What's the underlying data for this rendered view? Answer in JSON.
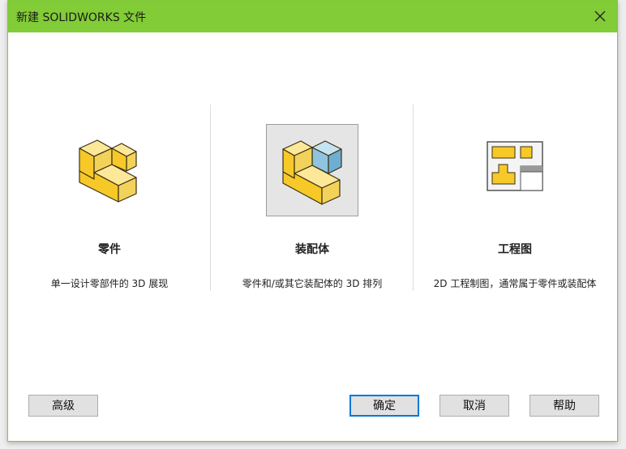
{
  "window": {
    "title": "新建 SOLIDWORKS 文件"
  },
  "options": [
    {
      "label": "零件",
      "description": "单一设计零部件的 3D 展现",
      "icon": "part-icon",
      "selected": false
    },
    {
      "label": "装配体",
      "description": "零件和/或其它装配体的 3D 排列",
      "icon": "assembly-icon",
      "selected": true
    },
    {
      "label": "工程图",
      "description": "2D 工程制图，通常属于零件或装配体",
      "icon": "drawing-icon",
      "selected": false
    }
  ],
  "buttons": {
    "advanced": "高级",
    "ok": "确定",
    "cancel": "取消",
    "help": "帮助"
  },
  "colors": {
    "titlebar": "#82cc37",
    "part_yellow": "#f7c928",
    "assembly_blue": "#8fc4e0",
    "default_button_border": "#0078d7"
  }
}
